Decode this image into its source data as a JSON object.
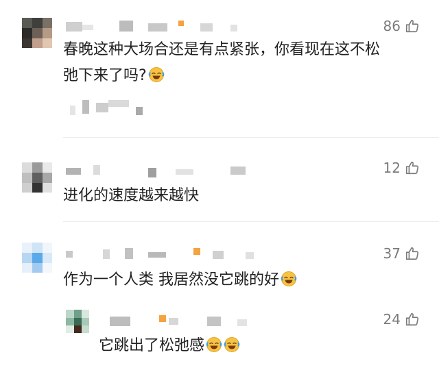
{
  "comments": [
    {
      "likes": "86",
      "text_line1": "春晚这种大场合还是有点紧张，你看现在这不松",
      "text_line2": "弛下来了吗?",
      "emoji": "laughing-crying-emoji"
    },
    {
      "likes": "12",
      "text": "进化的速度越来越快"
    },
    {
      "likes": "37",
      "text": "作为一个人类 我居然没它跳的好",
      "emoji": "laughing-crying-emoji"
    },
    {
      "likes": "24",
      "text": "它跳出了松弛感",
      "emoji": "laughing-crying-emoji"
    }
  ],
  "icons": {
    "like": "thumbs-up-icon"
  },
  "colors": {
    "text": "#222222",
    "muted": "#7b7b7b",
    "divider": "#ececec",
    "emoji_yellow": "#f6c343"
  }
}
